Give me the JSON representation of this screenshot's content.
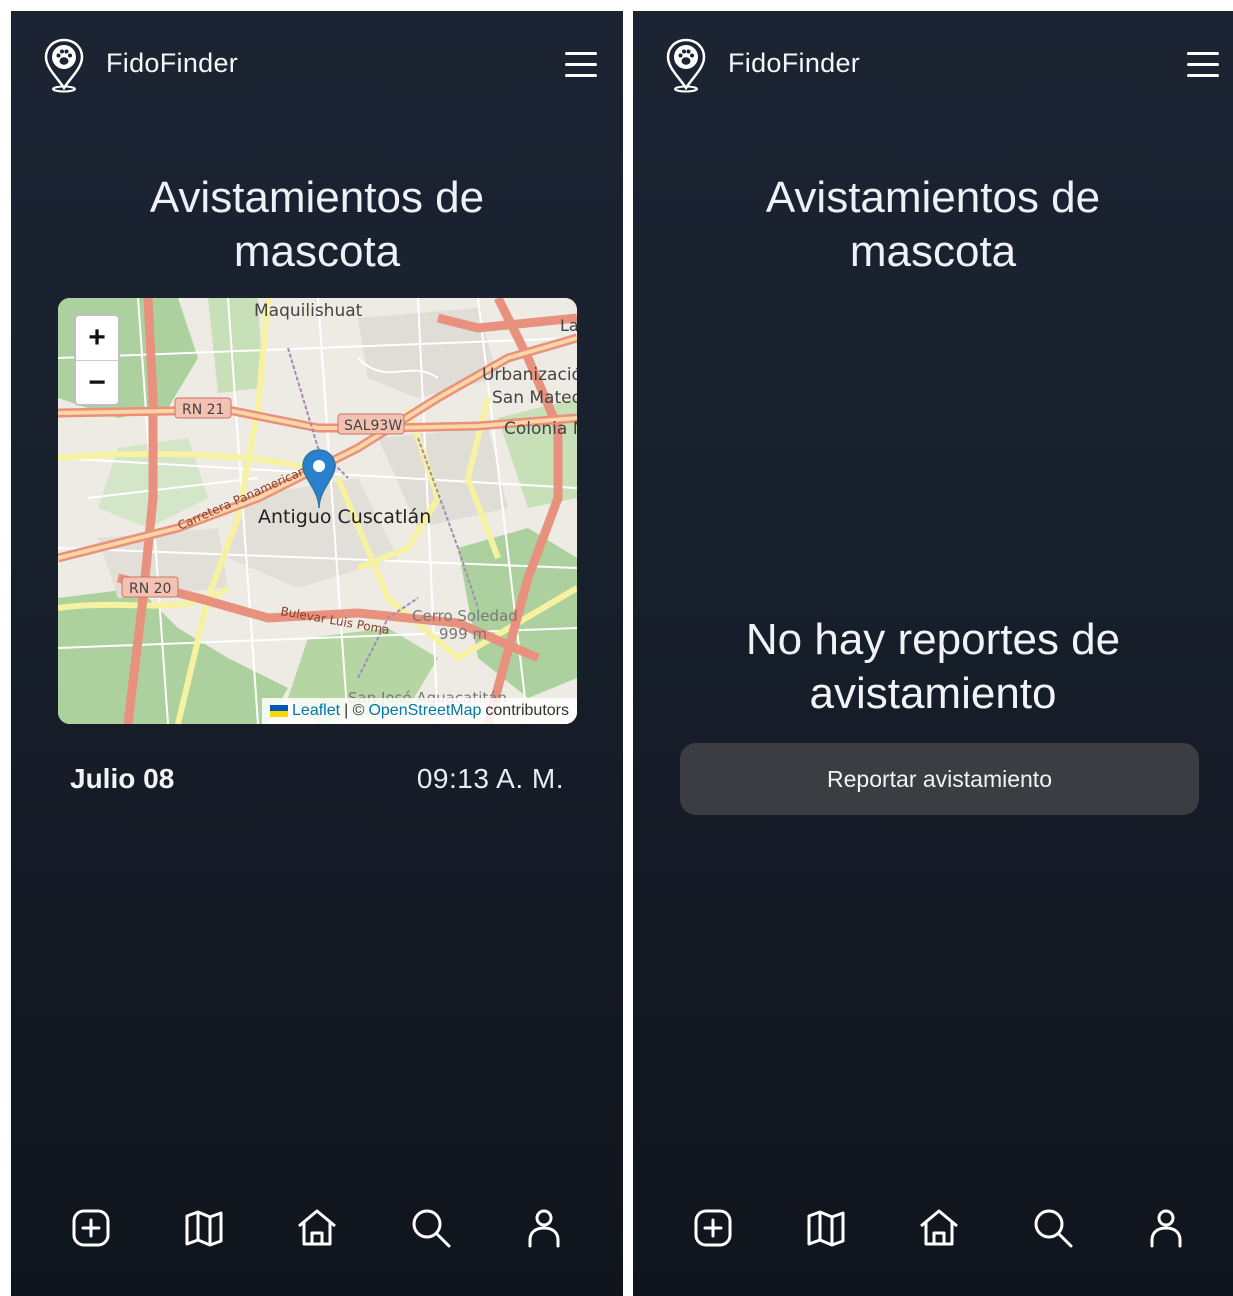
{
  "app": {
    "brand": "FidoFinder"
  },
  "left_screen": {
    "title_line1": "Avistamientos de",
    "title_line2": "mascota",
    "map": {
      "labels": {
        "maquilishuat": "Maquilishuat",
        "rn21": "RN 21",
        "sal93w": "SAL93W",
        "urbanizacion": "Urbanizació",
        "san_mateo": "San Mateo",
        "colonia": "Colonia M",
        "panamericana": "Carretera Panamericana",
        "antiguo_cuscatlan": "Antiguo Cuscatlán",
        "rn20": "RN 20",
        "bulevar": "Bulevar Luis Poma",
        "cerro_soledad": "Cerro Soledad",
        "elevation": "999 m",
        "san_jose": "San José Aguacatitán",
        "la": "La"
      },
      "zoom_in": "+",
      "zoom_out": "−",
      "attribution": {
        "leaflet": "Leaflet",
        "separator": "| ©",
        "osm": "OpenStreetMap",
        "contributors": "contributors"
      }
    },
    "sighting": {
      "date": "Julio 08",
      "time": "09:13 A. M."
    }
  },
  "right_screen": {
    "title_line1": "Avistamientos de",
    "title_line2": "mascota",
    "empty_line1": "No hay reportes de",
    "empty_line2": "avistamiento",
    "report_button": "Reportar avistamiento"
  },
  "bottom_nav": {
    "icons": [
      "add-square-icon",
      "map-icon",
      "home-icon",
      "search-icon",
      "user-icon"
    ]
  },
  "colors": {
    "background": "#1c2433",
    "button": "#3c3d42",
    "marker": "#2a81cb",
    "link": "#0078a8"
  }
}
